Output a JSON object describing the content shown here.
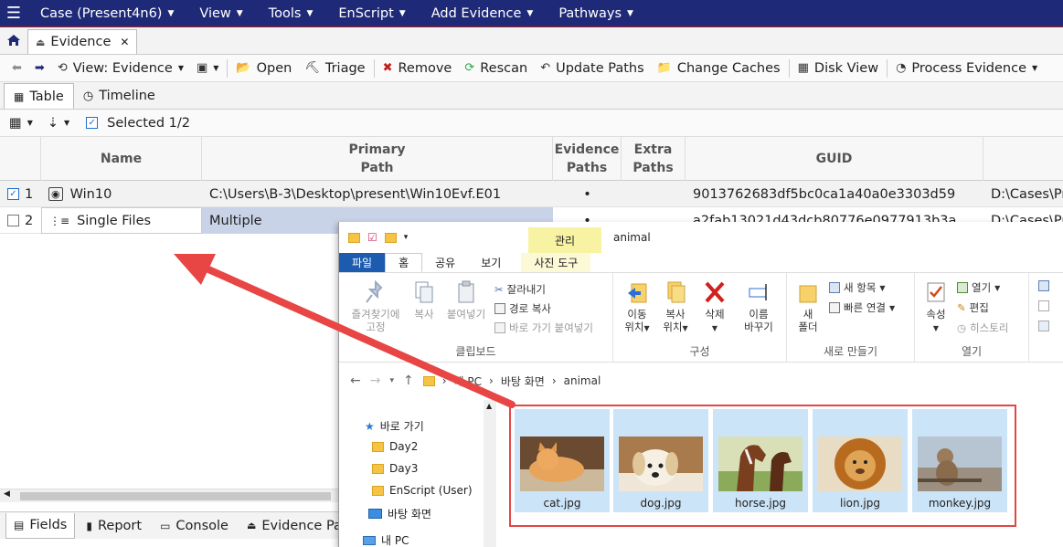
{
  "menubar": {
    "items": [
      "Case (Present4n6)",
      "View",
      "Tools",
      "EnScript",
      "Add Evidence",
      "Pathways"
    ]
  },
  "tabs": {
    "evidence_tab": "Evidence"
  },
  "toolbar": {
    "view": "View: Evidence",
    "open": "Open",
    "triage": "Triage",
    "remove": "Remove",
    "rescan": "Rescan",
    "update_paths": "Update Paths",
    "change_caches": "Change Caches",
    "disk_view": "Disk View",
    "process_evidence": "Process Evidence"
  },
  "subtabs": {
    "table": "Table",
    "timeline": "Timeline"
  },
  "selection": {
    "label": "Selected 1/2"
  },
  "table": {
    "headers": {
      "name": "Name",
      "primary_path_1": "Primary",
      "primary_path_2": "Path",
      "evidence_paths_1": "Evidence",
      "evidence_paths_2": "Paths",
      "extra_paths_1": "Extra",
      "extra_paths_2": "Paths",
      "guid": "GUID"
    },
    "rows": [
      {
        "num": "1",
        "name": "Win10",
        "path": "C:\\Users\\B-3\\Desktop\\present\\Win10Evf.E01",
        "evidence_paths": "•",
        "guid": "9013762683df5bc0ca1a40a0e3303d59",
        "extra": "D:\\Cases\\Pr"
      },
      {
        "num": "2",
        "name": "Single Files",
        "path": "Multiple",
        "evidence_paths": "•",
        "guid": "a2fab13021d43dcb80776e0977913b3a",
        "extra": "D:\\Cases\\Pr"
      }
    ]
  },
  "bottomtabs": {
    "fields": "Fields",
    "report": "Report",
    "console": "Console",
    "evidence_pa": "Evidence Pa"
  },
  "explorer": {
    "manage": "관리",
    "folder_name": "animal",
    "ribbon_tabs": {
      "file": "파일",
      "home": "홈",
      "share": "공유",
      "view": "보기",
      "photo_tools": "사진 도구"
    },
    "ribbon": {
      "pin": "즐겨찾기에",
      "pin2": "고정",
      "copy": "복사",
      "paste": "붙여넣기",
      "cut": "잘라내기",
      "copy_path": "경로 복사",
      "paste_shortcut": "바로 가기 붙여넣기",
      "clipboard": "클립보드",
      "move_to": "이동",
      "move_to2": "위치",
      "copy_to": "복사",
      "copy_to2": "위치",
      "delete": "삭제",
      "rename": "이름",
      "rename2": "바꾸기",
      "organize": "구성",
      "new_folder": "새",
      "new_folder2": "폴더",
      "new_item": "새 항목",
      "easy_access": "빠른 연결",
      "new": "새로 만들기",
      "properties": "속성",
      "open": "열기",
      "edit": "편집",
      "history": "히스토리",
      "open_group": "열기"
    },
    "address": {
      "pc": "내 PC",
      "desktop": "바탕 화면",
      "folder": "animal"
    },
    "nav": {
      "quick_access": "바로 가기",
      "day2": "Day2",
      "day3": "Day3",
      "enscript_user": "EnScript (User)",
      "desktop": "바탕 화면",
      "this_pc": "내 PC"
    },
    "files": [
      "cat.jpg",
      "dog.jpg",
      "horse.jpg",
      "lion.jpg",
      "monkey.jpg"
    ]
  },
  "colors": {
    "menubar": "#1e2a78",
    "highlight_frame": "#e04848",
    "arrow": "#e84545",
    "tile_selected": "#cce4f7"
  }
}
